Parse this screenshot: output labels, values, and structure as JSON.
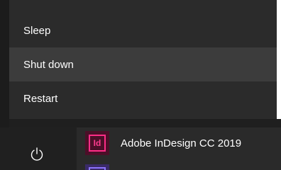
{
  "power_menu": {
    "items": [
      {
        "label": "Sleep"
      },
      {
        "label": "Shut down"
      },
      {
        "label": "Restart"
      }
    ]
  },
  "start_list": {
    "apps": [
      {
        "label": "Adobe InDesign CC 2019",
        "icon_text": "Id",
        "icon": "indesign-icon"
      }
    ]
  },
  "icons": {
    "power": "power-icon"
  },
  "colors": {
    "menu_bg": "#2b2b2b",
    "menu_hover": "#3c3c3c",
    "indesign_accent": "#ff2d87"
  }
}
